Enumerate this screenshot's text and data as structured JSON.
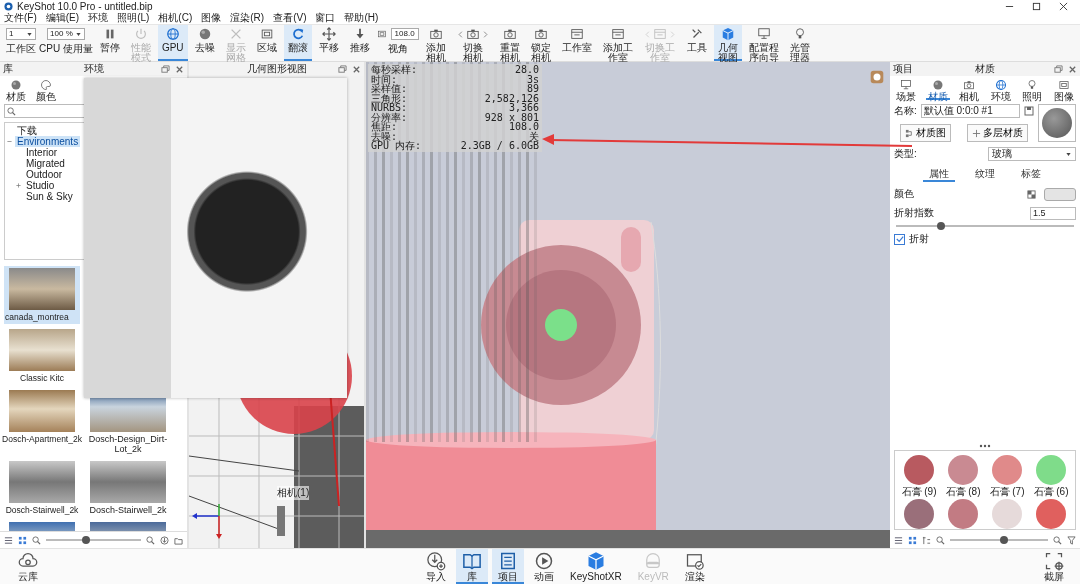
{
  "window": {
    "title": "KeyShot 10.0 Pro  - untitled.bip"
  },
  "menu": [
    "文件(F)",
    "编辑(E)",
    "环境",
    "照明(L)",
    "相机(C)",
    "图像",
    "渲染(R)",
    "查看(V)",
    "窗口",
    "帮助(H)"
  ],
  "toolbar": [
    {
      "kind": "dropdown",
      "value": "1",
      "label": "工作区"
    },
    {
      "kind": "dropdown",
      "value": "100 %",
      "label": "CPU 使用量"
    },
    {
      "kind": "button",
      "label": "暂停",
      "selected": false,
      "disabled": false
    },
    {
      "kind": "button",
      "label": "性能模式",
      "selected": false,
      "disabled": true
    },
    {
      "kind": "button",
      "label": "GPU",
      "selected": true,
      "disabled": false
    },
    {
      "kind": "button",
      "label": "去噪",
      "selected": false,
      "disabled": false
    },
    {
      "kind": "button",
      "label": "显示网格",
      "selected": false,
      "disabled": true
    },
    {
      "kind": "button",
      "label": "区域",
      "selected": false,
      "disabled": false
    },
    {
      "kind": "button",
      "label": "翻滚",
      "selected": true,
      "disabled": false
    },
    {
      "kind": "button",
      "label": "平移",
      "selected": false,
      "disabled": false
    },
    {
      "kind": "button",
      "label": "推移",
      "selected": false,
      "disabled": false
    },
    {
      "kind": "field",
      "value": "108.0",
      "label": "视角"
    },
    {
      "kind": "button",
      "label": "添加相机",
      "selected": false,
      "disabled": false
    },
    {
      "kind": "switcher",
      "label": "切换相机",
      "selected": false,
      "disabled": false
    },
    {
      "kind": "button",
      "label": "重置相机",
      "selected": false,
      "disabled": false
    },
    {
      "kind": "button",
      "label": "锁定相机",
      "selected": false,
      "disabled": false
    },
    {
      "kind": "button",
      "label": "工作室",
      "selected": false,
      "disabled": false
    },
    {
      "kind": "button",
      "label": "添加工作室",
      "selected": false,
      "disabled": false
    },
    {
      "kind": "switcher",
      "label": "切换工作室",
      "selected": false,
      "disabled": true
    },
    {
      "kind": "button",
      "label": "工具",
      "selected": false,
      "disabled": false
    },
    {
      "kind": "button",
      "label": "几何视图",
      "selected": true,
      "disabled": false
    },
    {
      "kind": "button",
      "label": "配置程序向导",
      "selected": false,
      "disabled": false
    },
    {
      "kind": "button",
      "label": "光管理器",
      "selected": false,
      "disabled": false
    }
  ],
  "library": {
    "title": "库",
    "panel_title": "环境",
    "tabs": [
      {
        "label": "材质",
        "selected": false
      },
      {
        "label": "颜色",
        "selected": false
      }
    ],
    "tree": [
      {
        "label": "下载",
        "selected": false
      },
      {
        "label": "Environments",
        "selected": true,
        "expanded": true,
        "children": [
          {
            "label": "Interior",
            "selected": false
          },
          {
            "label": "Migrated",
            "selected": false
          },
          {
            "label": "Outdoor",
            "selected": false
          },
          {
            "label": "Studio",
            "selected": false,
            "expanded": false
          },
          {
            "label": "Sun & Sky",
            "selected": false
          }
        ]
      }
    ],
    "thumbnail_rows": [
      [
        {
          "label": "canada_montrea",
          "selected": true
        }
      ],
      [
        {
          "label": "Classic Kitc",
          "selected": false
        }
      ],
      [
        {
          "label": "Dosch-Apartment_2k",
          "selected": false
        },
        {
          "label": "Dosch-Design_Dirt-Lot_2k",
          "selected": false
        }
      ],
      [
        {
          "label": "Dosch-Stairwell_2k",
          "selected": false
        },
        {
          "label": "Dosch-Stairwell_2k",
          "selected": false
        }
      ],
      [
        {
          "selected": false
        },
        {
          "selected": false
        }
      ]
    ],
    "zoom": {
      "level": 0.42
    }
  },
  "geometry_view": {
    "title": "几何图形视图",
    "camera_label": "相机(1)"
  },
  "viewport": {
    "stats": [
      {
        "label": "每秒采样:",
        "value": "28.0"
      },
      {
        "label": "时间:",
        "value": "3s"
      },
      {
        "label": "采样值:",
        "value": "89"
      },
      {
        "label": "三角形:",
        "value": "2,582,126"
      },
      {
        "label": "NURBS:",
        "value": "3,366"
      },
      {
        "label": "分辨率:",
        "value": "928 x 801"
      },
      {
        "label": "焦距:",
        "value": "108.0"
      },
      {
        "label": "去噪:",
        "value": "关"
      },
      {
        "label": "GPU 内存:",
        "value": "2.3GB / 6.0GB"
      }
    ]
  },
  "material_panel": {
    "title": "项目",
    "panel_title": "材质",
    "tabs": [
      {
        "label": "场景",
        "selected": false
      },
      {
        "label": "材质",
        "selected": true
      },
      {
        "label": "相机",
        "selected": false
      },
      {
        "label": "环境",
        "selected": false
      },
      {
        "label": "照明",
        "selected": false
      },
      {
        "label": "图像",
        "selected": false
      }
    ],
    "name_label": "名称:",
    "name_value": "默认值 0:0:0 #1",
    "buttons": [
      "材质图",
      "多层材质"
    ],
    "type_label": "类型:",
    "type_value": "玻璃",
    "subtabs": [
      {
        "label": "属性",
        "selected": true
      },
      {
        "label": "纹理",
        "selected": false
      },
      {
        "label": "标签",
        "selected": false
      }
    ],
    "properties": [
      {
        "kind": "color",
        "label": "颜色"
      },
      {
        "kind": "slider",
        "label": "折射指数",
        "value": "1.5",
        "level": 0.25
      },
      {
        "kind": "checkbox",
        "label": "折射",
        "checked": true
      }
    ]
  },
  "material_library": {
    "materials": [
      {
        "label": "石膏 (9)",
        "color": "#b85a60"
      },
      {
        "label": "石膏 (8)",
        "color": "#c98a92"
      },
      {
        "label": "石膏 (7)",
        "color": "#e08a8a"
      },
      {
        "label": "石膏 (6)",
        "color": "#7fdc8a"
      },
      {
        "color": "#9a6f7a"
      },
      {
        "color": "#c27b83"
      },
      {
        "color": "#e6dada"
      },
      {
        "color": "#e0605e"
      }
    ],
    "zoom": {
      "level": 0.55
    }
  },
  "dock": {
    "left": {
      "label": "云库"
    },
    "center": [
      {
        "label": "导入",
        "selected": false,
        "disabled": false
      },
      {
        "label": "库",
        "selected": true,
        "disabled": false
      },
      {
        "label": "项目",
        "selected": true,
        "disabled": false
      },
      {
        "label": "动画",
        "selected": false,
        "disabled": false
      },
      {
        "label": "KeyShotXR",
        "selected": false,
        "disabled": false
      },
      {
        "label": "KeyVR",
        "selected": false,
        "disabled": true
      },
      {
        "label": "渲染",
        "selected": false,
        "disabled": false
      }
    ],
    "right": {
      "label": "截屏"
    }
  }
}
